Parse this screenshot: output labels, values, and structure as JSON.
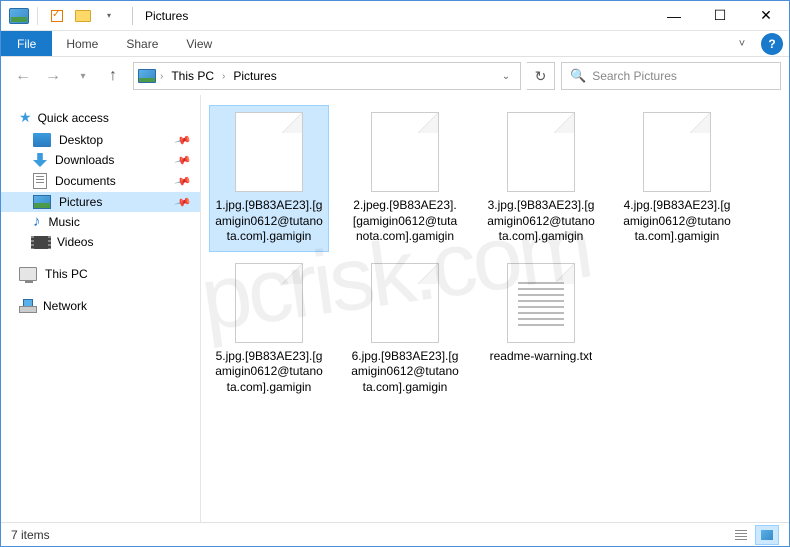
{
  "window": {
    "title": "Pictures"
  },
  "ribbon": {
    "file": "File",
    "tabs": [
      "Home",
      "Share",
      "View"
    ]
  },
  "breadcrumb": {
    "items": [
      "This PC",
      "Pictures"
    ]
  },
  "search": {
    "placeholder": "Search Pictures"
  },
  "sidebar": {
    "quick_access": "Quick access",
    "items": [
      {
        "label": "Desktop",
        "icon": "desktop",
        "pinned": true
      },
      {
        "label": "Downloads",
        "icon": "downloads",
        "pinned": true
      },
      {
        "label": "Documents",
        "icon": "documents",
        "pinned": true
      },
      {
        "label": "Pictures",
        "icon": "pictures",
        "pinned": true,
        "selected": true
      },
      {
        "label": "Music",
        "icon": "music",
        "pinned": false
      },
      {
        "label": "Videos",
        "icon": "videos",
        "pinned": false
      }
    ],
    "this_pc": "This PC",
    "network": "Network"
  },
  "files": [
    {
      "name": "1.jpg.[9B83AE23].[gamigin0612@tutanota.com].gamigin",
      "type": "blank",
      "selected": true
    },
    {
      "name": "2.jpeg.[9B83AE23].[gamigin0612@tutanota.com].gamigin",
      "type": "blank"
    },
    {
      "name": "3.jpg.[9B83AE23].[gamigin0612@tutanota.com].gamigin",
      "type": "blank"
    },
    {
      "name": "4.jpg.[9B83AE23].[gamigin0612@tutanota.com].gamigin",
      "type": "blank"
    },
    {
      "name": "5.jpg.[9B83AE23].[gamigin0612@tutanota.com].gamigin",
      "type": "blank"
    },
    {
      "name": "6.jpg.[9B83AE23].[gamigin0612@tutanota.com].gamigin",
      "type": "blank"
    },
    {
      "name": "readme-warning.txt",
      "type": "txt"
    }
  ],
  "status": {
    "item_count": "7 items"
  },
  "watermark": "pcrisk.com"
}
